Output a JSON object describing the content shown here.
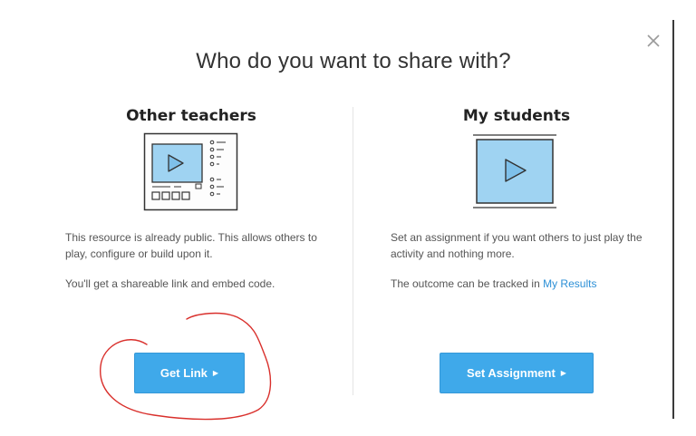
{
  "dialog": {
    "title": "Who do you want to share with?",
    "close_icon": "close-icon",
    "accent_color": "#3fa9ea",
    "link_color": "#2b8fd6",
    "annotation_color": "#d9302c"
  },
  "teachers": {
    "heading": "Other teachers",
    "illustration_icon": "resource-page-icon",
    "description_1": "This resource is already public. This allows others to play, configure or build upon it.",
    "description_2": "You'll get a shareable link and embed code.",
    "button_label": "Get Link",
    "button_icon": "triangle-right-icon"
  },
  "students": {
    "heading": "My students",
    "illustration_icon": "video-player-icon",
    "description_1": "Set an assignment if you want others to just play the activity and nothing more.",
    "description_2_prefix": "The outcome can be tracked in ",
    "description_2_link": "My Results",
    "button_label": "Set Assignment",
    "button_icon": "triangle-right-icon"
  }
}
